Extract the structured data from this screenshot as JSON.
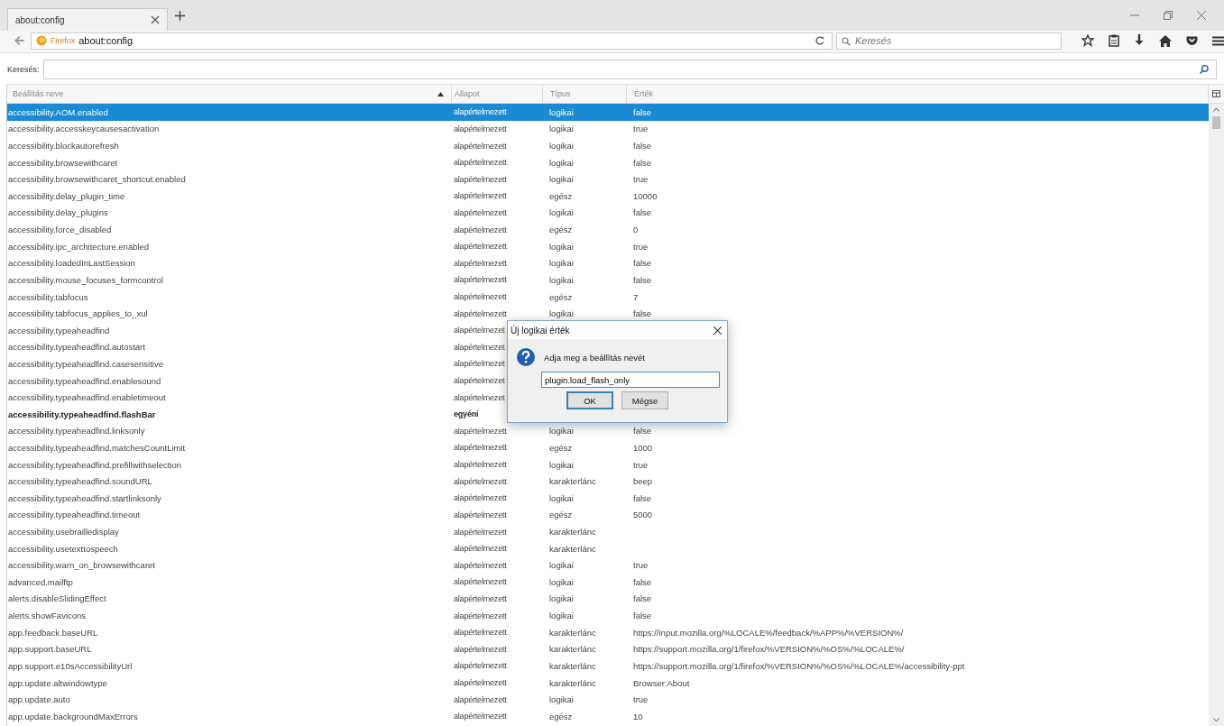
{
  "tab": {
    "title": "about:config"
  },
  "toolbar": {
    "identity": "Firefox",
    "url": "about:config",
    "search_placeholder": "Keresés"
  },
  "filter": {
    "label": "Keresés:"
  },
  "table": {
    "columns": [
      "Beállítás neve",
      "Állapot",
      "Típus",
      "Érték"
    ],
    "rows": [
      {
        "name": "accessibility.AOM.enabled",
        "status": "alapértelmezett",
        "type": "logikai",
        "value": "false",
        "selected": true,
        "modified": false
      },
      {
        "name": "accessibility.accesskeycausesactivation",
        "status": "alapértelmezett",
        "type": "logikai",
        "value": "true",
        "selected": false,
        "modified": false
      },
      {
        "name": "accessibility.blockautorefresh",
        "status": "alapértelmezett",
        "type": "logikai",
        "value": "false",
        "selected": false,
        "modified": false
      },
      {
        "name": "accessibility.browsewithcaret",
        "status": "alapértelmezett",
        "type": "logikai",
        "value": "false",
        "selected": false,
        "modified": false
      },
      {
        "name": "accessibility.browsewithcaret_shortcut.enabled",
        "status": "alapértelmezett",
        "type": "logikai",
        "value": "true",
        "selected": false,
        "modified": false
      },
      {
        "name": "accessibility.delay_plugin_time",
        "status": "alapértelmezett",
        "type": "egész",
        "value": "10000",
        "selected": false,
        "modified": false
      },
      {
        "name": "accessibility.delay_plugins",
        "status": "alapértelmezett",
        "type": "logikai",
        "value": "false",
        "selected": false,
        "modified": false
      },
      {
        "name": "accessibility.force_disabled",
        "status": "alapértelmezett",
        "type": "egész",
        "value": "0",
        "selected": false,
        "modified": false
      },
      {
        "name": "accessibility.ipc_architecture.enabled",
        "status": "alapértelmezett",
        "type": "logikai",
        "value": "true",
        "selected": false,
        "modified": false
      },
      {
        "name": "accessibility.loadedInLastSession",
        "status": "alapértelmezett",
        "type": "logikai",
        "value": "false",
        "selected": false,
        "modified": false
      },
      {
        "name": "accessibility.mouse_focuses_formcontrol",
        "status": "alapértelmezett",
        "type": "logikai",
        "value": "false",
        "selected": false,
        "modified": false
      },
      {
        "name": "accessibility.tabfocus",
        "status": "alapértelmezett",
        "type": "egész",
        "value": "7",
        "selected": false,
        "modified": false
      },
      {
        "name": "accessibility.tabfocus_applies_to_xul",
        "status": "alapértelmezett",
        "type": "logikai",
        "value": "false",
        "selected": false,
        "modified": false
      },
      {
        "name": "accessibility.typeaheadfind",
        "status": "alapértelmezet",
        "selected": false,
        "modified": false
      },
      {
        "name": "accessibility.typeaheadfind.autostart",
        "status": "alapértelmezet",
        "selected": false,
        "modified": false
      },
      {
        "name": "accessibility.typeaheadfind.casesensitive",
        "status": "alapértelmezet",
        "selected": false,
        "modified": false
      },
      {
        "name": "accessibility.typeaheadfind.enablesound",
        "status": "alapértelmezet",
        "selected": false,
        "modified": false
      },
      {
        "name": "accessibility.typeaheadfind.enabletimeout",
        "status": "alapértelmezet",
        "selected": false,
        "modified": false
      },
      {
        "name": "accessibility.typeaheadfind.flashBar",
        "status": "egyéni",
        "selected": false,
        "modified": true
      },
      {
        "name": "accessibility.typeaheadfind.linksonly",
        "status": "alapértelmezett",
        "type": "logikai",
        "value": "false",
        "selected": false,
        "modified": false
      },
      {
        "name": "accessibility.typeaheadfind.matchesCountLimit",
        "status": "alapértelmezett",
        "type": "egész",
        "value": "1000",
        "selected": false,
        "modified": false
      },
      {
        "name": "accessibility.typeaheadfind.prefillwithselection",
        "status": "alapértelmezett",
        "type": "logikai",
        "value": "true",
        "selected": false,
        "modified": false
      },
      {
        "name": "accessibility.typeaheadfind.soundURL",
        "status": "alapértelmezett",
        "type": "karakterlánc",
        "value": "beep",
        "selected": false,
        "modified": false
      },
      {
        "name": "accessibility.typeaheadfind.startlinksonly",
        "status": "alapértelmezett",
        "type": "logikai",
        "value": "false",
        "selected": false,
        "modified": false
      },
      {
        "name": "accessibility.typeaheadfind.timeout",
        "status": "alapértelmezett",
        "type": "egész",
        "value": "5000",
        "selected": false,
        "modified": false
      },
      {
        "name": "accessibility.usebrailledisplay",
        "status": "alapértelmezett",
        "type": "karakterlánc",
        "selected": false,
        "modified": false
      },
      {
        "name": "accessibility.usetexttospeech",
        "status": "alapértelmezett",
        "type": "karakterlánc",
        "selected": false,
        "modified": false
      },
      {
        "name": "accessibility.warn_on_browsewithcaret",
        "status": "alapértelmezett",
        "type": "logikai",
        "value": "true",
        "selected": false,
        "modified": false
      },
      {
        "name": "advanced.mailftp",
        "status": "alapértelmezett",
        "type": "logikai",
        "value": "false",
        "selected": false,
        "modified": false
      },
      {
        "name": "alerts.disableSlidingEffect",
        "status": "alapértelmezett",
        "type": "logikai",
        "value": "false",
        "selected": false,
        "modified": false
      },
      {
        "name": "alerts.showFavicons",
        "status": "alapértelmezett",
        "type": "logikai",
        "value": "false",
        "selected": false,
        "modified": false
      },
      {
        "name": "app.feedback.baseURL",
        "status": "alapértelmezett",
        "type": "karakterlánc",
        "value": "https://input.mozilla.org/%LOCALE%/feedback/%APP%/%VERSION%/",
        "selected": false,
        "modified": false
      },
      {
        "name": "app.support.baseURL",
        "status": "alapértelmezett",
        "type": "karakterlánc",
        "value": "https://support.mozilla.org/1/firefox/%VERSION%/%OS%/%LOCALE%/",
        "selected": false,
        "modified": false
      },
      {
        "name": "app.support.e10sAccessibilityUrl",
        "status": "alapértelmezett",
        "type": "karakterlánc",
        "value": "https://support.mozilla.org/1/firefox/%VERSION%/%OS%/%LOCALE%/accessibility-ppt",
        "selected": false,
        "modified": false
      },
      {
        "name": "app.update.altwindowtype",
        "status": "alapértelmezett",
        "type": "karakterlánc",
        "value": "Browser:About",
        "selected": false,
        "modified": false
      },
      {
        "name": "app.update.auto",
        "status": "alapértelmezett",
        "type": "logikai",
        "value": "true",
        "selected": false,
        "modified": false
      },
      {
        "name": "app.update.backgroundMaxErrors",
        "status": "alapértelmezett",
        "type": "egész",
        "value": "10",
        "selected": false,
        "modified": false
      }
    ]
  },
  "dialog": {
    "title": "Új logikai érték",
    "prompt": "Adja meg a beállítás nevét",
    "value": "plugin.load_flash_only",
    "buttons": [
      {
        "label": "OK",
        "selected": true
      },
      {
        "label": "Mégse",
        "selected": false
      }
    ]
  }
}
